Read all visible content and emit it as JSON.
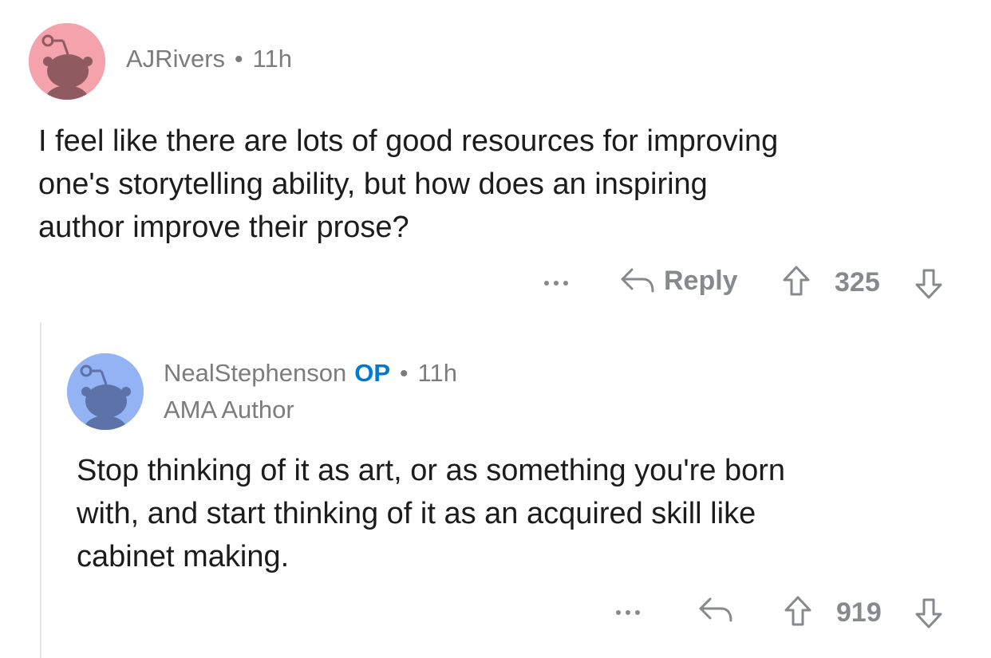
{
  "parent_comment": {
    "username": "AJRivers",
    "separator": "•",
    "time": "11h",
    "avatar_color": "#f4a3ad",
    "body_lines": [
      "I feel like there are lots of good resources for improving",
      "one's storytelling ability, but how does an inspiring",
      "author improve their prose?"
    ],
    "actions": {
      "more_icon": "more-dots-icon",
      "reply_icon": "reply-arrow-icon",
      "reply_label": "Reply",
      "upvote_icon": "upvote-arrow-icon",
      "vote_count": "325",
      "downvote_icon": "downvote-arrow-icon"
    }
  },
  "reply_comment": {
    "username": "NealStephenson",
    "op_badge": "OP",
    "separator": "•",
    "time": "11h",
    "flair": "AMA Author",
    "avatar_color": "#94b3f4",
    "body_lines": [
      "Stop thinking of it as art, or as something you're born",
      "with, and start thinking of it as an acquired skill like",
      "cabinet making."
    ],
    "actions": {
      "more_icon": "more-dots-icon",
      "reply_icon": "reply-arrow-icon",
      "upvote_icon": "upvote-arrow-icon",
      "vote_count": "919",
      "downvote_icon": "downvote-arrow-icon"
    }
  },
  "colors": {
    "meta_gray": "#7c7c7c",
    "action_gray": "#878a8c",
    "op_blue": "#0079d3",
    "text": "#1c1c1c",
    "thread_line": "#e6e6e6"
  }
}
